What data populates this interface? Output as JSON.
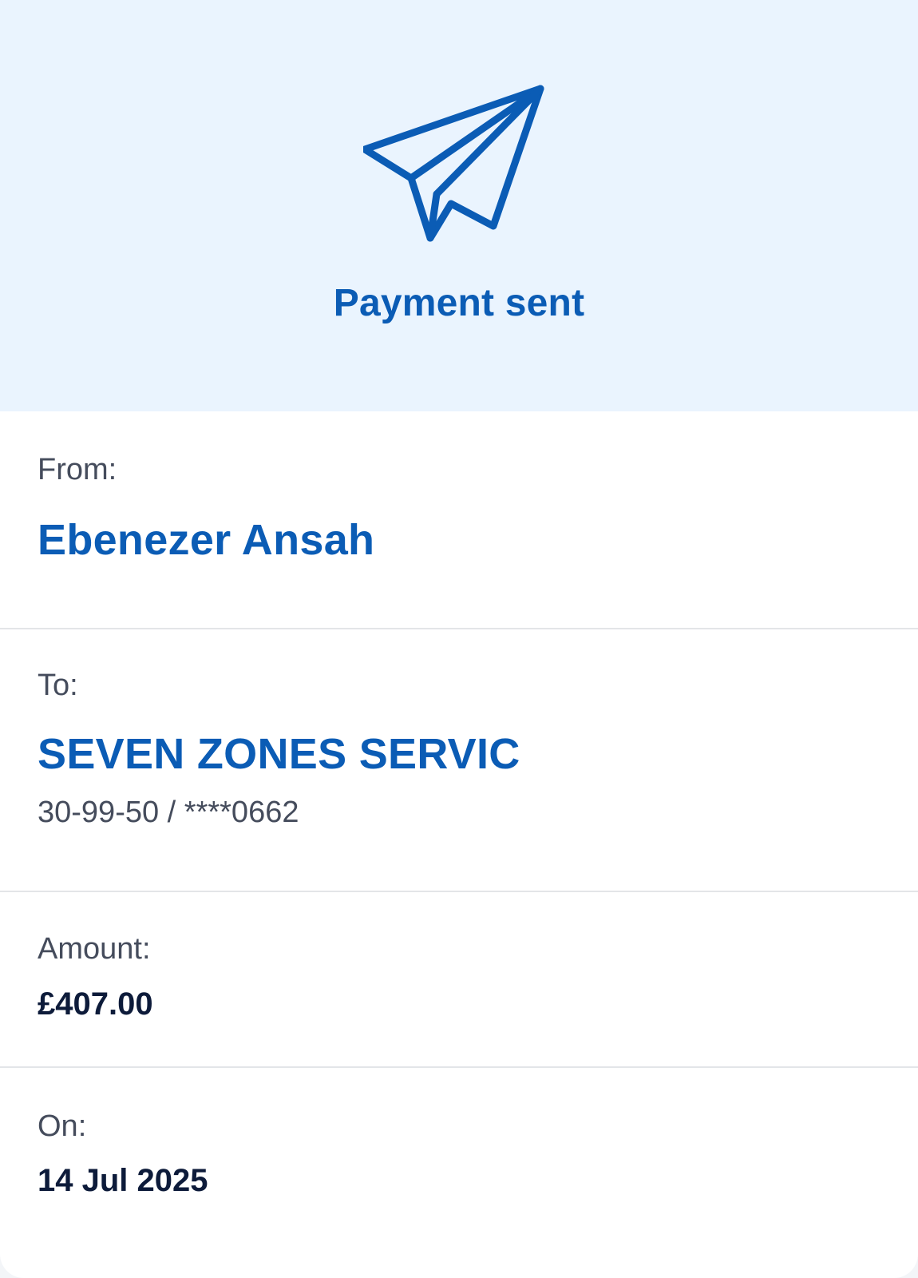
{
  "header": {
    "title": "Payment sent",
    "icon": "paper-plane-icon",
    "accent_color": "#0b5cb5",
    "background_color": "#eaf4fe"
  },
  "from": {
    "label": "From:",
    "name": "Ebenezer Ansah"
  },
  "to": {
    "label": "To:",
    "name": "SEVEN ZONES SERVIC",
    "account": "30-99-50 / ****0662"
  },
  "amount": {
    "label": "Amount:",
    "value": "£407.00"
  },
  "date": {
    "label": "On:",
    "value": "14 Jul 2025"
  }
}
